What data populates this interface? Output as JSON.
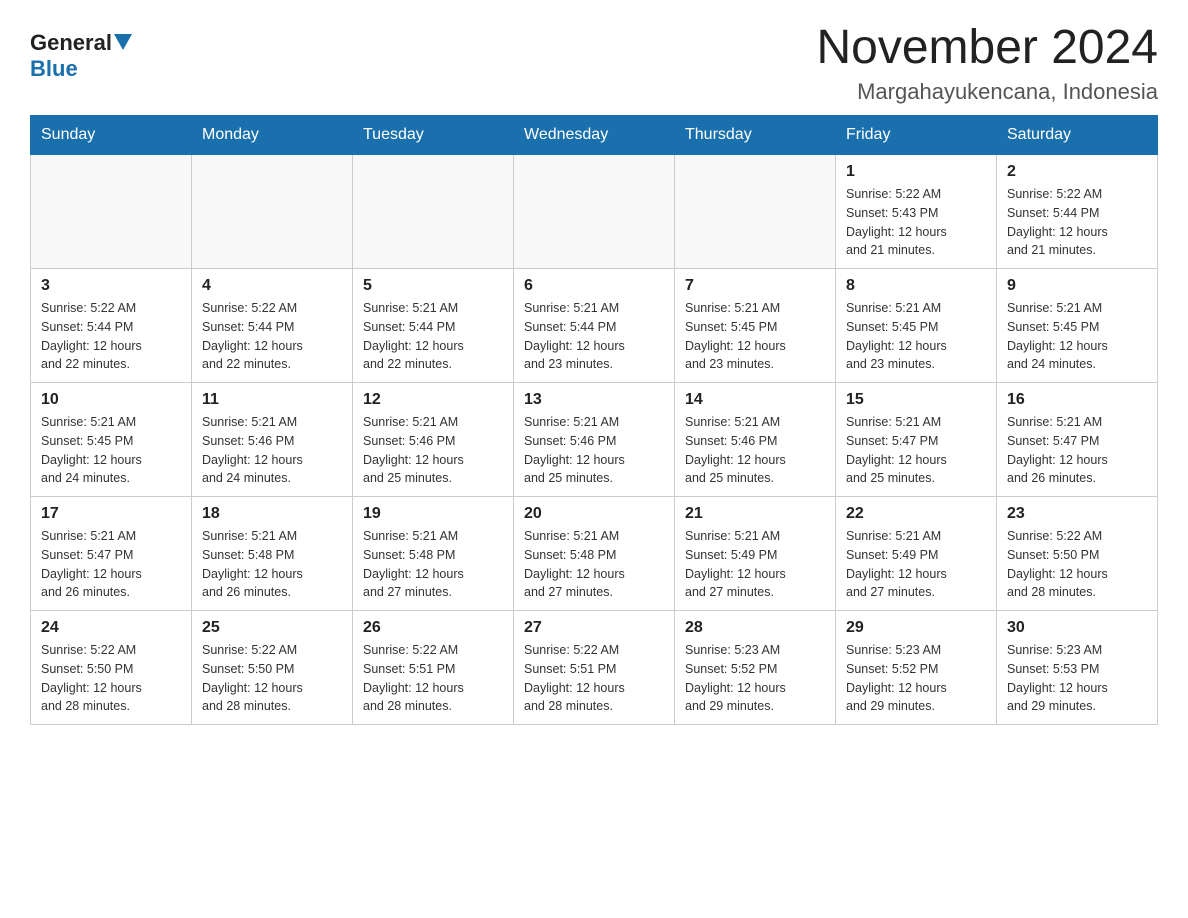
{
  "logo": {
    "general": "General",
    "blue": "Blue"
  },
  "title": "November 2024",
  "subtitle": "Margahayukencana, Indonesia",
  "weekdays": [
    "Sunday",
    "Monday",
    "Tuesday",
    "Wednesday",
    "Thursday",
    "Friday",
    "Saturday"
  ],
  "weeks": [
    [
      {
        "day": "",
        "info": ""
      },
      {
        "day": "",
        "info": ""
      },
      {
        "day": "",
        "info": ""
      },
      {
        "day": "",
        "info": ""
      },
      {
        "day": "",
        "info": ""
      },
      {
        "day": "1",
        "info": "Sunrise: 5:22 AM\nSunset: 5:43 PM\nDaylight: 12 hours\nand 21 minutes."
      },
      {
        "day": "2",
        "info": "Sunrise: 5:22 AM\nSunset: 5:44 PM\nDaylight: 12 hours\nand 21 minutes."
      }
    ],
    [
      {
        "day": "3",
        "info": "Sunrise: 5:22 AM\nSunset: 5:44 PM\nDaylight: 12 hours\nand 22 minutes."
      },
      {
        "day": "4",
        "info": "Sunrise: 5:22 AM\nSunset: 5:44 PM\nDaylight: 12 hours\nand 22 minutes."
      },
      {
        "day": "5",
        "info": "Sunrise: 5:21 AM\nSunset: 5:44 PM\nDaylight: 12 hours\nand 22 minutes."
      },
      {
        "day": "6",
        "info": "Sunrise: 5:21 AM\nSunset: 5:44 PM\nDaylight: 12 hours\nand 23 minutes."
      },
      {
        "day": "7",
        "info": "Sunrise: 5:21 AM\nSunset: 5:45 PM\nDaylight: 12 hours\nand 23 minutes."
      },
      {
        "day": "8",
        "info": "Sunrise: 5:21 AM\nSunset: 5:45 PM\nDaylight: 12 hours\nand 23 minutes."
      },
      {
        "day": "9",
        "info": "Sunrise: 5:21 AM\nSunset: 5:45 PM\nDaylight: 12 hours\nand 24 minutes."
      }
    ],
    [
      {
        "day": "10",
        "info": "Sunrise: 5:21 AM\nSunset: 5:45 PM\nDaylight: 12 hours\nand 24 minutes."
      },
      {
        "day": "11",
        "info": "Sunrise: 5:21 AM\nSunset: 5:46 PM\nDaylight: 12 hours\nand 24 minutes."
      },
      {
        "day": "12",
        "info": "Sunrise: 5:21 AM\nSunset: 5:46 PM\nDaylight: 12 hours\nand 25 minutes."
      },
      {
        "day": "13",
        "info": "Sunrise: 5:21 AM\nSunset: 5:46 PM\nDaylight: 12 hours\nand 25 minutes."
      },
      {
        "day": "14",
        "info": "Sunrise: 5:21 AM\nSunset: 5:46 PM\nDaylight: 12 hours\nand 25 minutes."
      },
      {
        "day": "15",
        "info": "Sunrise: 5:21 AM\nSunset: 5:47 PM\nDaylight: 12 hours\nand 25 minutes."
      },
      {
        "day": "16",
        "info": "Sunrise: 5:21 AM\nSunset: 5:47 PM\nDaylight: 12 hours\nand 26 minutes."
      }
    ],
    [
      {
        "day": "17",
        "info": "Sunrise: 5:21 AM\nSunset: 5:47 PM\nDaylight: 12 hours\nand 26 minutes."
      },
      {
        "day": "18",
        "info": "Sunrise: 5:21 AM\nSunset: 5:48 PM\nDaylight: 12 hours\nand 26 minutes."
      },
      {
        "day": "19",
        "info": "Sunrise: 5:21 AM\nSunset: 5:48 PM\nDaylight: 12 hours\nand 27 minutes."
      },
      {
        "day": "20",
        "info": "Sunrise: 5:21 AM\nSunset: 5:48 PM\nDaylight: 12 hours\nand 27 minutes."
      },
      {
        "day": "21",
        "info": "Sunrise: 5:21 AM\nSunset: 5:49 PM\nDaylight: 12 hours\nand 27 minutes."
      },
      {
        "day": "22",
        "info": "Sunrise: 5:21 AM\nSunset: 5:49 PM\nDaylight: 12 hours\nand 27 minutes."
      },
      {
        "day": "23",
        "info": "Sunrise: 5:22 AM\nSunset: 5:50 PM\nDaylight: 12 hours\nand 28 minutes."
      }
    ],
    [
      {
        "day": "24",
        "info": "Sunrise: 5:22 AM\nSunset: 5:50 PM\nDaylight: 12 hours\nand 28 minutes."
      },
      {
        "day": "25",
        "info": "Sunrise: 5:22 AM\nSunset: 5:50 PM\nDaylight: 12 hours\nand 28 minutes."
      },
      {
        "day": "26",
        "info": "Sunrise: 5:22 AM\nSunset: 5:51 PM\nDaylight: 12 hours\nand 28 minutes."
      },
      {
        "day": "27",
        "info": "Sunrise: 5:22 AM\nSunset: 5:51 PM\nDaylight: 12 hours\nand 28 minutes."
      },
      {
        "day": "28",
        "info": "Sunrise: 5:23 AM\nSunset: 5:52 PM\nDaylight: 12 hours\nand 29 minutes."
      },
      {
        "day": "29",
        "info": "Sunrise: 5:23 AM\nSunset: 5:52 PM\nDaylight: 12 hours\nand 29 minutes."
      },
      {
        "day": "30",
        "info": "Sunrise: 5:23 AM\nSunset: 5:53 PM\nDaylight: 12 hours\nand 29 minutes."
      }
    ]
  ]
}
